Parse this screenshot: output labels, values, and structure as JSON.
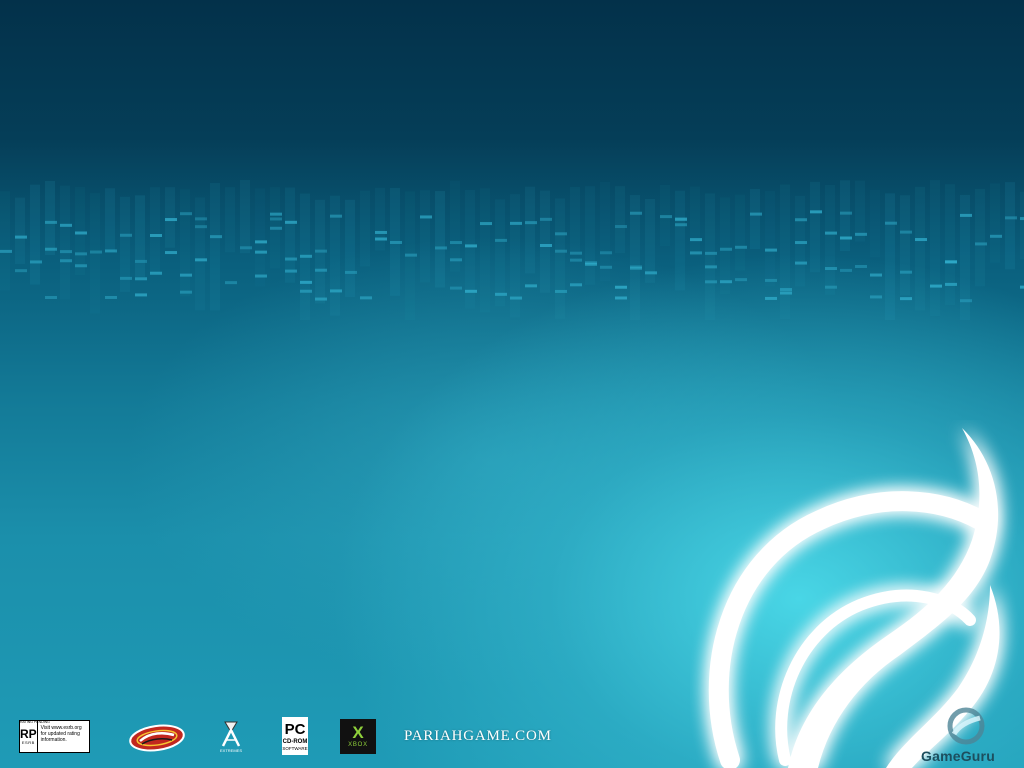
{
  "background": {
    "colors": {
      "top": "#03314a",
      "mid": "#137a97",
      "bottom": "#1f9bb6",
      "glow": "#49d6e6"
    }
  },
  "emblem": {
    "icon": "pariah-emblem-icon",
    "color": "#ffffff"
  },
  "footer": {
    "rating": {
      "code": "RP",
      "rating_pending_label": "RATING PENDING",
      "esrb_label": "ESRB",
      "text": "Visit www.esrb.org for updated rating information."
    },
    "logos": {
      "groove": "groove-games-logo",
      "digital_extremes": "digital-extremes-logo",
      "digital_extremes_caption": "EXTREMES",
      "pc": {
        "title": "PC",
        "line1": "CD-ROM",
        "line2": "SOFTWARE"
      },
      "xbox": {
        "mark": "X",
        "label": "XBOX"
      }
    },
    "url": "PARIAHGAME.COM",
    "watermark": {
      "icon": "gameguru-logo-icon",
      "text": "GameGuru"
    }
  }
}
